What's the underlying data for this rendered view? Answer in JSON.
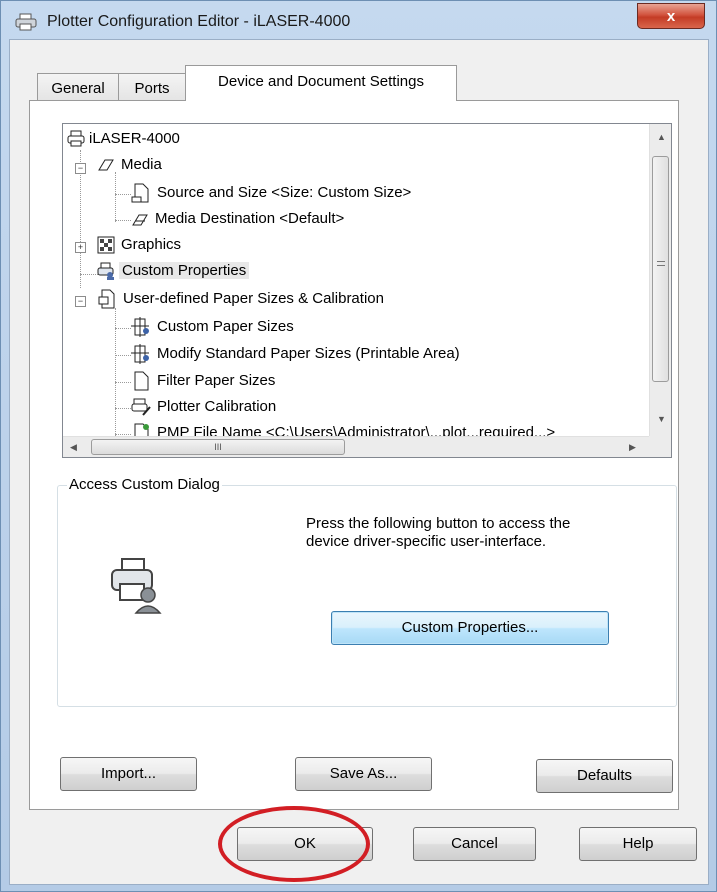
{
  "window": {
    "title": "Plotter Configuration Editor - iLASER-4000",
    "close_label": "x"
  },
  "tabs": [
    {
      "label": "General",
      "active": false
    },
    {
      "label": "Ports",
      "active": false
    },
    {
      "label": "Device and Document Settings",
      "active": true
    }
  ],
  "tree": {
    "root": "iLASER-4000",
    "items": [
      {
        "label": "Media",
        "icon": "media-icon",
        "expander": "−"
      },
      {
        "label": "Source and Size <Size: Custom Size>",
        "icon": "page-icon"
      },
      {
        "label": "Media Destination <Default>",
        "icon": "media-destination-icon"
      },
      {
        "label": "Graphics",
        "icon": "graphics-icon",
        "expander": "+"
      },
      {
        "label": "Custom Properties",
        "icon": "custom-properties-icon",
        "selected": true
      },
      {
        "label": "User-defined Paper Sizes & Calibration",
        "icon": "paper-stack-icon",
        "expander": "−"
      },
      {
        "label": "Custom Paper Sizes",
        "icon": "paper-size-icon"
      },
      {
        "label": "Modify Standard Paper Sizes (Printable Area)",
        "icon": "paper-size-icon"
      },
      {
        "label": "Filter Paper Sizes",
        "icon": "blank-page-icon"
      },
      {
        "label": "Plotter Calibration",
        "icon": "calibration-icon"
      },
      {
        "label": "PMP File Name <C:\\Users\\Administrator\\...plot...required...>",
        "icon": "pmp-file-icon"
      }
    ],
    "hscroll_grip": "III"
  },
  "group": {
    "label": "Access Custom Dialog",
    "description_line1": "Press the following button to access the",
    "description_line2": "device driver-specific user-interface.",
    "button_label": "Custom Properties..."
  },
  "panel_buttons": {
    "import": "Import...",
    "save_as": "Save As...",
    "defaults": "Defaults"
  },
  "dialog_buttons": {
    "ok": "OK",
    "cancel": "Cancel",
    "help": "Help"
  },
  "colors": {
    "highlight_circle": "#d21e24",
    "title_bar": "#c5d9ef",
    "close_button": "#c43c26"
  }
}
